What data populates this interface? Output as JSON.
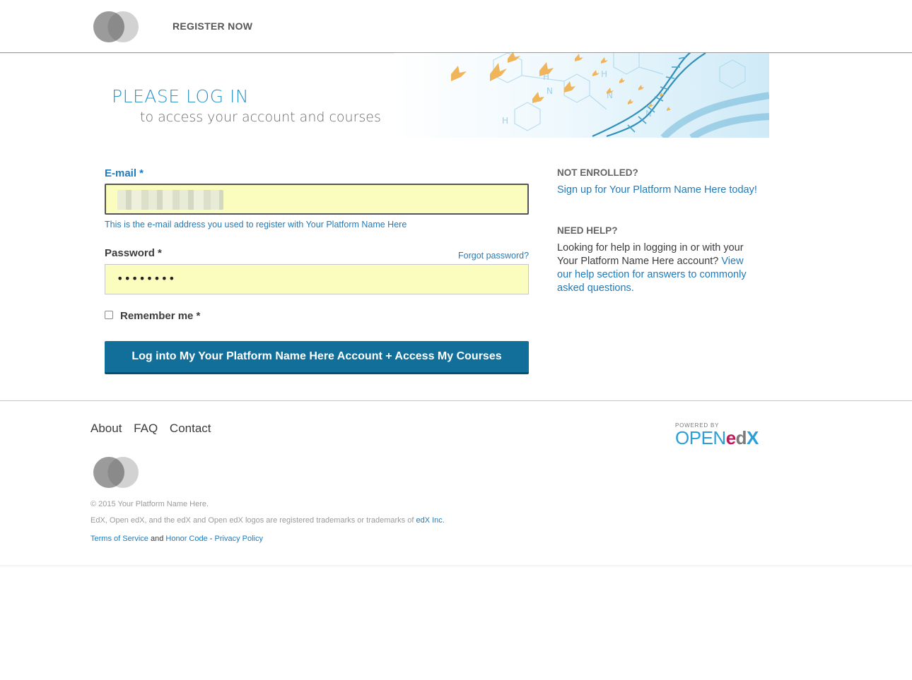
{
  "header": {
    "register_label": "REGISTER NOW"
  },
  "banner": {
    "title": "PLEASE LOG IN",
    "subtitle": "to access your account and courses"
  },
  "form": {
    "email_label": "E-mail *",
    "email_hint": "This is the e-mail address you used to register with Your Platform Name Here",
    "password_label": "Password *",
    "password_value": "••••••••",
    "forgot_label": "Forgot password?",
    "remember_label": "Remember me *",
    "remember_checked": false,
    "submit_label": "Log into My Your Platform Name Here Account  +  Access My Courses"
  },
  "sidebar": {
    "not_enrolled_heading": "NOT ENROLLED?",
    "signup_link": "Sign up for Your Platform Name Here today!",
    "need_help_heading": "NEED HELP?",
    "help_text": "Looking for help in logging in or with your Your Platform Name Here account?",
    "help_link": "View our help section for answers to commonly asked questions."
  },
  "footer": {
    "nav": [
      "About",
      "FAQ",
      "Contact"
    ],
    "copyright": "© 2015 Your Platform Name Here.",
    "trademark_text": "EdX, Open edX, and the edX and Open edX logos are registered trademarks or trademarks of",
    "trademark_link": "edX Inc.",
    "terms_label": "Terms of Service",
    "and_text": "and",
    "honor_label": "Honor Code",
    "separator": "-",
    "privacy_label": "Privacy Policy",
    "powered_by": "POWERED BY",
    "brand_open": "OPEN",
    "brand_e": "e",
    "brand_d": "d",
    "brand_x": "X"
  },
  "colors": {
    "accent": "#1f7bbb",
    "button": "#126f9a",
    "input_fill": "#fafdbd"
  }
}
